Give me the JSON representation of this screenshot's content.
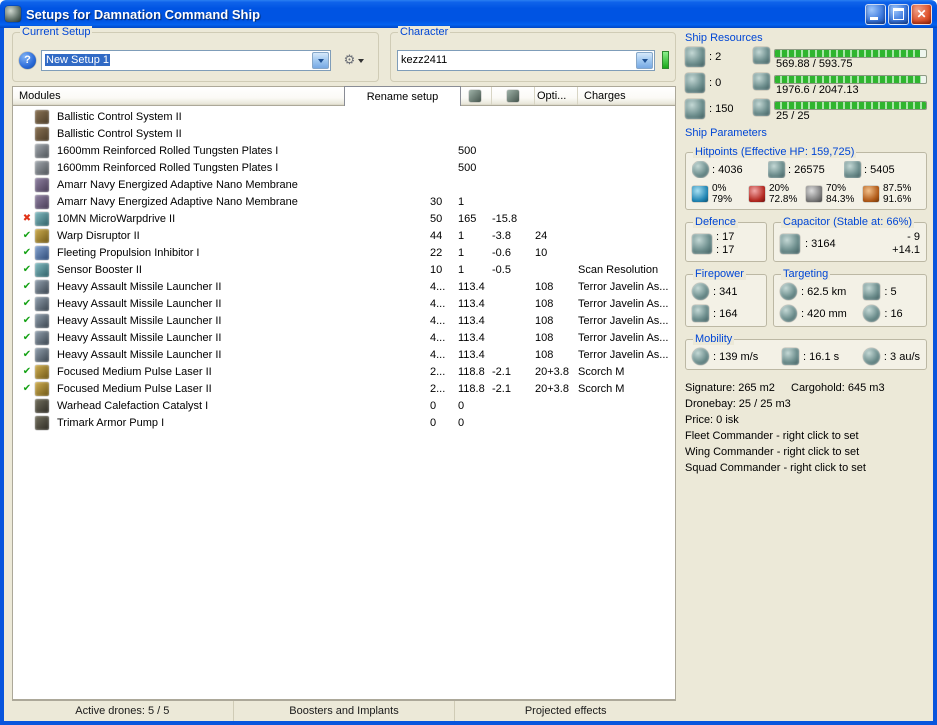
{
  "window": {
    "title": "Setups for Damnation Command Ship"
  },
  "setup": {
    "group_label": "Current Setup",
    "value": "New Setup 1"
  },
  "character": {
    "group_label": "Character",
    "value": "kezz2411"
  },
  "modules_table": {
    "col_modules": "Modules",
    "col_opti": "Opti...",
    "col_charges": "Charges",
    "rename_tab": "Rename setup",
    "rows": [
      {
        "status": "none",
        "icon": "ballistic-control",
        "name": "Ballistic Control System II",
        "c1": "",
        "c2": "",
        "c3": "",
        "opti": "",
        "charges": ""
      },
      {
        "status": "none",
        "icon": "ballistic-control",
        "name": "Ballistic Control System II",
        "c1": "",
        "c2": "",
        "c3": "",
        "opti": "",
        "charges": ""
      },
      {
        "status": "none",
        "icon": "armor-plate",
        "name": "1600mm Reinforced Rolled Tungsten Plates I",
        "c1": "",
        "c2": "500",
        "c3": "",
        "opti": "",
        "charges": ""
      },
      {
        "status": "none",
        "icon": "armor-plate",
        "name": "1600mm Reinforced Rolled Tungsten Plates I",
        "c1": "",
        "c2": "500",
        "c3": "",
        "opti": "",
        "charges": ""
      },
      {
        "status": "none",
        "icon": "adaptive-membrane",
        "name": "Amarr Navy Energized Adaptive Nano Membrane",
        "c1": "",
        "c2": "",
        "c3": "",
        "opti": "",
        "charges": ""
      },
      {
        "status": "none",
        "icon": "adaptive-membrane",
        "name": "Amarr Navy Energized Adaptive Nano Membrane",
        "c1": "30",
        "c2": "1",
        "c3": "",
        "opti": "",
        "charges": ""
      },
      {
        "status": "offline",
        "icon": "microwarpdrive",
        "name": "10MN MicroWarpdrive II",
        "c1": "50",
        "c2": "165",
        "c3": "-15.8",
        "opti": "",
        "charges": ""
      },
      {
        "status": "active",
        "icon": "warp-disruptor",
        "name": "Warp Disruptor II",
        "c1": "44",
        "c2": "1",
        "c3": "-3.8",
        "opti": "24",
        "charges": ""
      },
      {
        "status": "active",
        "icon": "stasis-web",
        "name": "Fleeting Propulsion Inhibitor I",
        "c1": "22",
        "c2": "1",
        "c3": "-0.6",
        "opti": "10",
        "charges": ""
      },
      {
        "status": "active",
        "icon": "sensor-booster",
        "name": "Sensor Booster II",
        "c1": "10",
        "c2": "1",
        "c3": "-0.5",
        "opti": "",
        "charges": "Scan Resolution"
      },
      {
        "status": "active",
        "icon": "missile-launcher",
        "name": "Heavy Assault Missile Launcher II",
        "c1": "4...",
        "c2": "113.4",
        "c3": "",
        "opti": "108",
        "charges": "Terror Javelin As..."
      },
      {
        "status": "active",
        "icon": "missile-launcher",
        "name": "Heavy Assault Missile Launcher II",
        "c1": "4...",
        "c2": "113.4",
        "c3": "",
        "opti": "108",
        "charges": "Terror Javelin As..."
      },
      {
        "status": "active",
        "icon": "missile-launcher",
        "name": "Heavy Assault Missile Launcher II",
        "c1": "4...",
        "c2": "113.4",
        "c3": "",
        "opti": "108",
        "charges": "Terror Javelin As..."
      },
      {
        "status": "active",
        "icon": "missile-launcher",
        "name": "Heavy Assault Missile Launcher II",
        "c1": "4...",
        "c2": "113.4",
        "c3": "",
        "opti": "108",
        "charges": "Terror Javelin As..."
      },
      {
        "status": "active",
        "icon": "missile-launcher",
        "name": "Heavy Assault Missile Launcher II",
        "c1": "4...",
        "c2": "113.4",
        "c3": "",
        "opti": "108",
        "charges": "Terror Javelin As..."
      },
      {
        "status": "active",
        "icon": "pulse-laser",
        "name": "Focused Medium Pulse Laser II",
        "c1": "2...",
        "c2": "118.8",
        "c3": "-2.1",
        "opti": "20+3.8",
        "charges": "Scorch M"
      },
      {
        "status": "active",
        "icon": "pulse-laser",
        "name": "Focused Medium Pulse Laser II",
        "c1": "2...",
        "c2": "118.8",
        "c3": "-2.1",
        "opti": "20+3.8",
        "charges": "Scorch M"
      },
      {
        "status": "none",
        "icon": "rig-warhead",
        "name": "Warhead Calefaction Catalyst I",
        "c1": "0",
        "c2": "0",
        "c3": "",
        "opti": "",
        "charges": ""
      },
      {
        "status": "none",
        "icon": "rig-armor",
        "name": "Trimark Armor Pump I",
        "c1": "0",
        "c2": "0",
        "c3": "",
        "opti": "",
        "charges": ""
      }
    ]
  },
  "bottom_tabs": {
    "drones": "Active drones: 5 / 5",
    "boosters": "Boosters and Implants",
    "projected": "Projected effects"
  },
  "resources": {
    "label": "Ship Resources",
    "slots": [
      {
        "icon": "turret-hardpoints",
        "value": ": 2"
      },
      {
        "icon": "launcher-hardpoints",
        "value": ": 0"
      },
      {
        "icon": "calibration",
        "value": ": 150"
      }
    ],
    "bars": [
      {
        "icon": "cpu",
        "value": "569.88 / 593.75",
        "percent": 96
      },
      {
        "icon": "powergrid",
        "value": "1976.6 / 2047.13",
        "percent": 97
      },
      {
        "icon": "drone-bandwidth",
        "value": "25 / 25",
        "percent": 100
      }
    ]
  },
  "parameters": {
    "label": "Ship Parameters",
    "hitpoints": {
      "label": "Hitpoints (Effective HP: 159,725)",
      "shield": ": 4036",
      "armor": ": 26575",
      "hull": ": 5405",
      "resists": [
        {
          "type": "em",
          "shield": "0%",
          "armor": "79%"
        },
        {
          "type": "thermal",
          "shield": "20%",
          "armor": "72.8%"
        },
        {
          "type": "kinetic",
          "shield": "70%",
          "armor": "84.3%"
        },
        {
          "type": "explosive",
          "shield": "87.5%",
          "armor": "91.6%"
        }
      ]
    },
    "defence": {
      "label": "Defence",
      "top": ": 17",
      "bottom": ": 17"
    },
    "capacitor": {
      "label": "Capacitor (Stable at: 66%)",
      "amount": ": 3164",
      "delta_top": "- 9",
      "delta_bottom": "+14.1"
    },
    "firepower": {
      "label": "Firepower",
      "dps": ": 341",
      "volley": ": 164"
    },
    "targeting": {
      "label": "Targeting",
      "range": ": 62.5 km",
      "max_targets": ": 5",
      "scan_resolution": ": 420 mm",
      "sensor_strength": ": 16"
    },
    "mobility": {
      "label": "Mobility",
      "speed": ": 139 m/s",
      "align_time": ": 16.1 s",
      "warp_speed": ": 3 au/s"
    }
  },
  "stats": {
    "signature": "Signature: 265 m2",
    "cargohold": "Cargohold: 645 m3",
    "dronebay": "Dronebay: 25 / 25 m3",
    "price": "Price: 0 isk",
    "fleet": "Fleet Commander - right click to set",
    "wing": "Wing Commander - right click to set",
    "squad": "Squad Commander - right click to set"
  }
}
